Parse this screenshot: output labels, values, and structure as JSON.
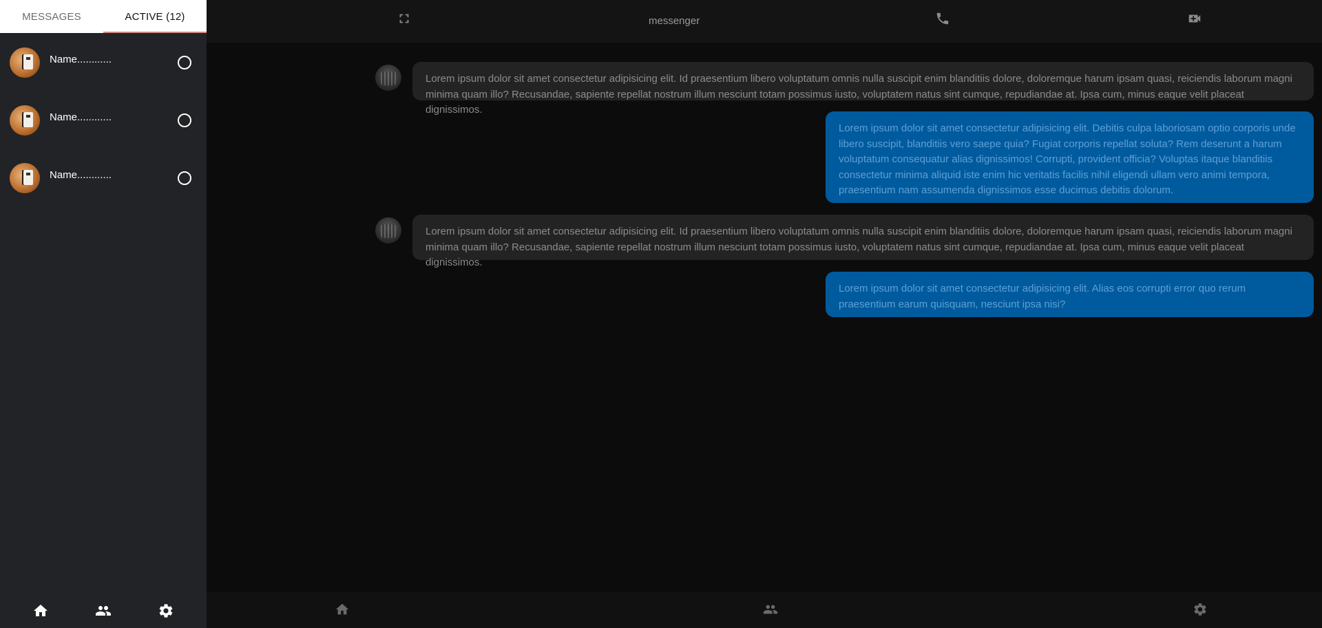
{
  "sidebar": {
    "tabs": [
      {
        "label": "MESSAGES",
        "active": false
      },
      {
        "label": "ACTIVE (12)",
        "active": true
      }
    ],
    "contacts": [
      {
        "name": "Name............",
        "avatar": "user-photo"
      },
      {
        "name": "Name............",
        "avatar": "user-photo"
      },
      {
        "name": "Name............",
        "avatar": "user-photo"
      }
    ],
    "nav": [
      {
        "icon": "home-icon"
      },
      {
        "icon": "people-icon"
      },
      {
        "icon": "settings-icon"
      }
    ]
  },
  "header": {
    "title": "messenger",
    "icons": [
      "fullscreen-icon",
      "phone-icon",
      "video-call-icon"
    ]
  },
  "messages": [
    {
      "direction": "incoming",
      "text": "Lorem ipsum dolor sit amet consectetur adipisicing elit. Id praesentium libero voluptatum omnis nulla suscipit enim blanditiis dolore, doloremque harum ipsam quasi, reiciendis laborum magni minima quam illo? Recusandae, sapiente repellat nostrum illum nesciunt totam possimus iusto, voluptatem natus sint cumque, repudiandae at. Ipsa cum, minus eaque velit placeat dignissimos."
    },
    {
      "direction": "outgoing",
      "text": "Lorem ipsum dolor sit amet consectetur adipisicing elit. Debitis culpa laboriosam optio corporis unde libero suscipit, blanditiis vero saepe quia? Fugiat corporis repellat soluta? Rem deserunt a harum voluptatum consequatur alias dignissimos! Corrupti, provident officia? Voluptas itaque blanditiis consectetur minima aliquid iste enim hic veritatis facilis nihil eligendi ullam vero animi tempora, praesentium nam assumenda dignissimos esse ducimus debitis dolorum."
    },
    {
      "direction": "incoming",
      "text": "Lorem ipsum dolor sit amet consectetur adipisicing elit. Id praesentium libero voluptatum omnis nulla suscipit enim blanditiis dolore, doloremque harum ipsam quasi, reiciendis laborum magni minima quam illo? Recusandae, sapiente repellat nostrum illum nesciunt totam possimus iusto, voluptatem natus sint cumque, repudiandae at. Ipsa cum, minus eaque velit placeat dignissimos."
    },
    {
      "direction": "outgoing",
      "text": "Lorem ipsum dolor sit amet consectetur adipisicing elit. Alias eos corrupti error quo rerum praesentium earum quisquam, nesciunt ipsa nisi?"
    }
  ],
  "bottom_nav": [
    {
      "icon": "home-icon"
    },
    {
      "icon": "people-icon"
    },
    {
      "icon": "settings-icon"
    }
  ],
  "colors": {
    "sidebar_bg": "#222326",
    "main_bg": "#0c0c0c",
    "incoming_bubble": "#232323",
    "outgoing_bubble": "#005b9e",
    "tab_underline": "#d88a82"
  }
}
